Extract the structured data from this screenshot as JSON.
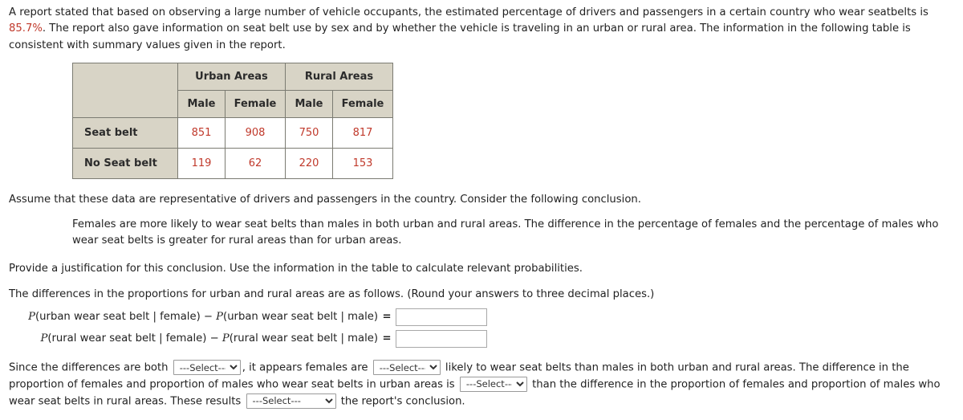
{
  "intro": {
    "part1": "A report stated that based on observing a large number of vehicle occupants, the estimated percentage of drivers and passengers in a certain country who wear seatbelts is ",
    "highlight": "85.7%",
    "part2": ". The report also gave information on seat belt use by sex and by whether the vehicle is traveling in an urban or rural area. The information in the following table is consistent with summary values given in the report."
  },
  "table": {
    "group_headers": [
      "Urban Areas",
      "Rural Areas"
    ],
    "sub_headers": [
      "Male",
      "Female",
      "Male",
      "Female"
    ],
    "rows": [
      {
        "label": "Seat belt",
        "values": [
          "851",
          "908",
          "750",
          "817"
        ]
      },
      {
        "label": "No Seat belt",
        "values": [
          "119",
          "62",
          "220",
          "153"
        ]
      }
    ],
    "header_bg": "#d8d4c6",
    "value_color": "#c0392b"
  },
  "assume_text": "Assume that these data are representative of drivers and passengers in the country. Consider the following conclusion.",
  "conclusion_text": "Females are more likely to wear seat belts than males in both urban and rural areas. The difference in the percentage of females and the percentage of males who wear seat belts is greater for rural areas than for urban areas.",
  "provide_text": "Provide a justification for this conclusion. Use the information in the table to calculate relevant probabilities.",
  "differences_text": "The differences in the proportions for urban and rural areas are as follows. (Round your answers to three decimal places.)",
  "equations": [
    {
      "p1_open": "P",
      "p1_body": "(urban wear seat belt | female)",
      "minus": " − ",
      "p2_open": "P",
      "p2_body": "(urban wear seat belt | male)",
      "equals": "=",
      "value": "",
      "placeholder": ""
    },
    {
      "p1_open": "P",
      "p1_body": "(rural wear seat belt | female)",
      "minus": " − ",
      "p2_open": "P",
      "p2_body": "(rural wear seat belt | male)",
      "equals": "=",
      "value": "",
      "placeholder": ""
    }
  ],
  "final": {
    "seg1": "Since the differences are both",
    "seg2": ", it appears females are",
    "seg3": "likely to wear seat belts than males in both urban and rural areas. The difference in the proportion of females and proportion of males who wear seat belts in urban areas is",
    "seg4": "than the difference in the proportion of females and proportion of males who wear seat belts in rural areas. These results",
    "seg5": "the report's conclusion.",
    "select_label": "---Select---",
    "selects": [
      {
        "name": "select-sign",
        "value": "---Select---"
      },
      {
        "name": "select-likelihood",
        "value": "---Select---"
      },
      {
        "name": "select-comparison",
        "value": "---Select---"
      },
      {
        "name": "select-support",
        "value": "---Select---"
      }
    ]
  }
}
